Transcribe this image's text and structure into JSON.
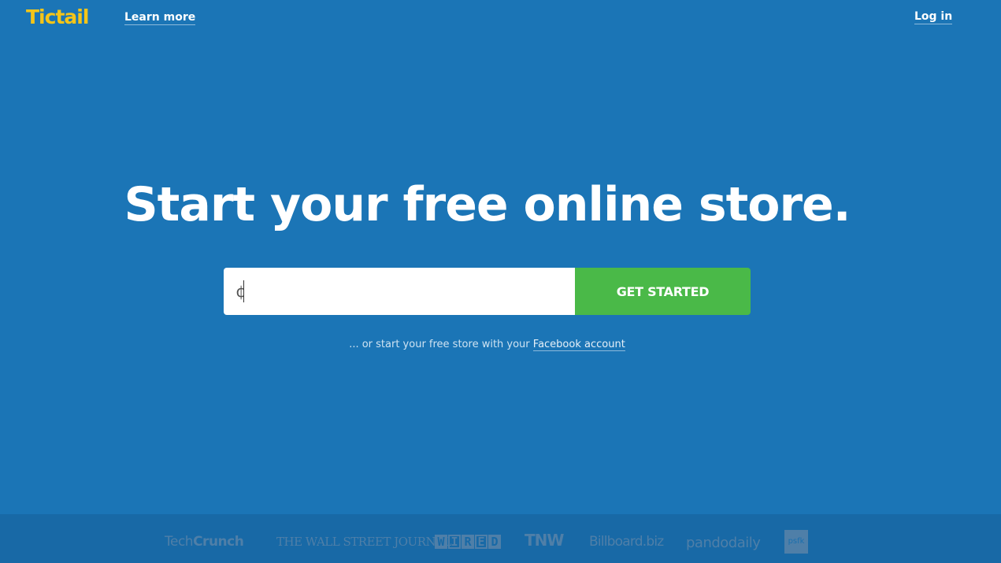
{
  "header": {
    "logo_text": "Tictail",
    "learn_more_label": "Learn more",
    "login_label": "Log in"
  },
  "hero": {
    "headline": "Start your free online store.",
    "input_prefix": "¢",
    "input_value": "",
    "button_label": "GET STARTED",
    "facebook_prefix": "... or start your free store with your ",
    "facebook_link_label": "Facebook account"
  },
  "press": {
    "logos": [
      {
        "name": "TechCrunch",
        "parts": [
          "Tech",
          "Crunch"
        ]
      },
      {
        "name": "THE WALL STREET JOURNAL."
      },
      {
        "name": "WIRED",
        "letters": [
          "W",
          "I",
          "R",
          "E",
          "D"
        ]
      },
      {
        "name": "TNW"
      },
      {
        "name": "Billboard.biz"
      },
      {
        "name": "pandodaily"
      },
      {
        "name": "psfk"
      }
    ]
  },
  "colors": {
    "background": "#1b75b6",
    "logo": "#f5c518",
    "button": "#4ab948",
    "press_bar": "#1869a6",
    "press_logo": "#4f7fa8"
  }
}
